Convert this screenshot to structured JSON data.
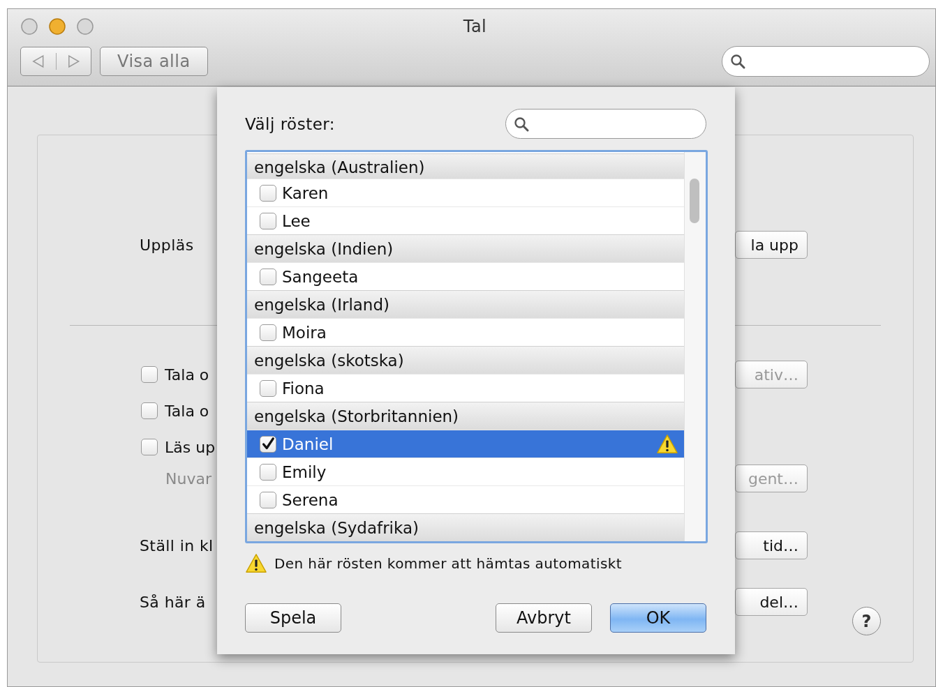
{
  "window": {
    "title": "Tal",
    "toolbar": {
      "show_all": "Visa alla"
    }
  },
  "background": {
    "rows": [
      {
        "kind": "label",
        "text": "Uppläs",
        "button": "la upp",
        "button_disabled": false
      },
      {
        "kind": "checkbox",
        "text": "Tala o",
        "checked": false,
        "button": "ativ…",
        "button_disabled": true
      },
      {
        "kind": "checkbox",
        "text": "Tala o",
        "checked": false
      },
      {
        "kind": "checkbox",
        "text": "Läs up",
        "checked": false
      },
      {
        "kind": "note",
        "text": "Nuvar",
        "button": "gent…",
        "button_disabled": true
      },
      {
        "kind": "label",
        "text": "Ställ in kl",
        "button": "tid…",
        "button_disabled": false
      },
      {
        "kind": "label",
        "text": "Så här ä",
        "button": "del…",
        "button_disabled": false
      }
    ],
    "help": "?"
  },
  "sheet": {
    "label": "Välj röster:",
    "voice_groups": [
      {
        "name": "engelska (Australien)",
        "voices": [
          {
            "name": "Karen",
            "checked": false,
            "selected": false,
            "warning": false
          },
          {
            "name": "Lee",
            "checked": false,
            "selected": false,
            "warning": false
          }
        ]
      },
      {
        "name": "engelska (Indien)",
        "voices": [
          {
            "name": "Sangeeta",
            "checked": false,
            "selected": false,
            "warning": false
          }
        ]
      },
      {
        "name": "engelska (Irland)",
        "voices": [
          {
            "name": "Moira",
            "checked": false,
            "selected": false,
            "warning": false
          }
        ]
      },
      {
        "name": "engelska (skotska)",
        "voices": [
          {
            "name": "Fiona",
            "checked": false,
            "selected": false,
            "warning": false
          }
        ]
      },
      {
        "name": "engelska (Storbritannien)",
        "voices": [
          {
            "name": "Daniel",
            "checked": true,
            "selected": true,
            "warning": true
          },
          {
            "name": "Emily",
            "checked": false,
            "selected": false,
            "warning": false
          },
          {
            "name": "Serena",
            "checked": false,
            "selected": false,
            "warning": false
          }
        ]
      },
      {
        "name": "engelska (Sydafrika)"
      }
    ],
    "note": "Den här rösten kommer att hämtas automatiskt",
    "buttons": [
      {
        "label": "Spela",
        "default": false
      },
      {
        "label": "Avbryt",
        "default": false
      },
      {
        "label": "OK",
        "default": true
      }
    ]
  }
}
